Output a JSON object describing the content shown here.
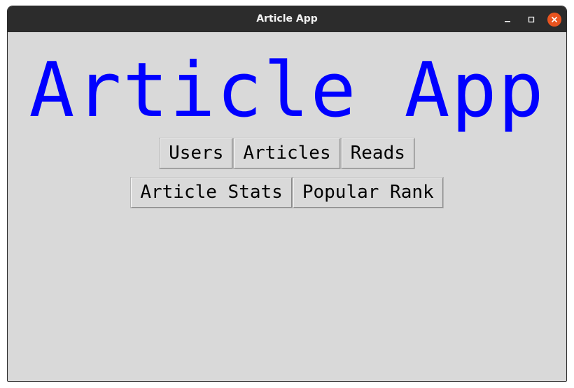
{
  "window": {
    "title": "Article App",
    "controls": {
      "minimize_icon": "minimize-icon",
      "maximize_icon": "maximize-icon",
      "close_icon": "close-icon",
      "close_color": "#e9541f"
    }
  },
  "main": {
    "heading": "Article App",
    "heading_color": "#0000ff",
    "buttons_row1": [
      "Users",
      "Articles",
      "Reads"
    ],
    "buttons_row2": [
      "Article Stats",
      "Popular Rank"
    ]
  }
}
